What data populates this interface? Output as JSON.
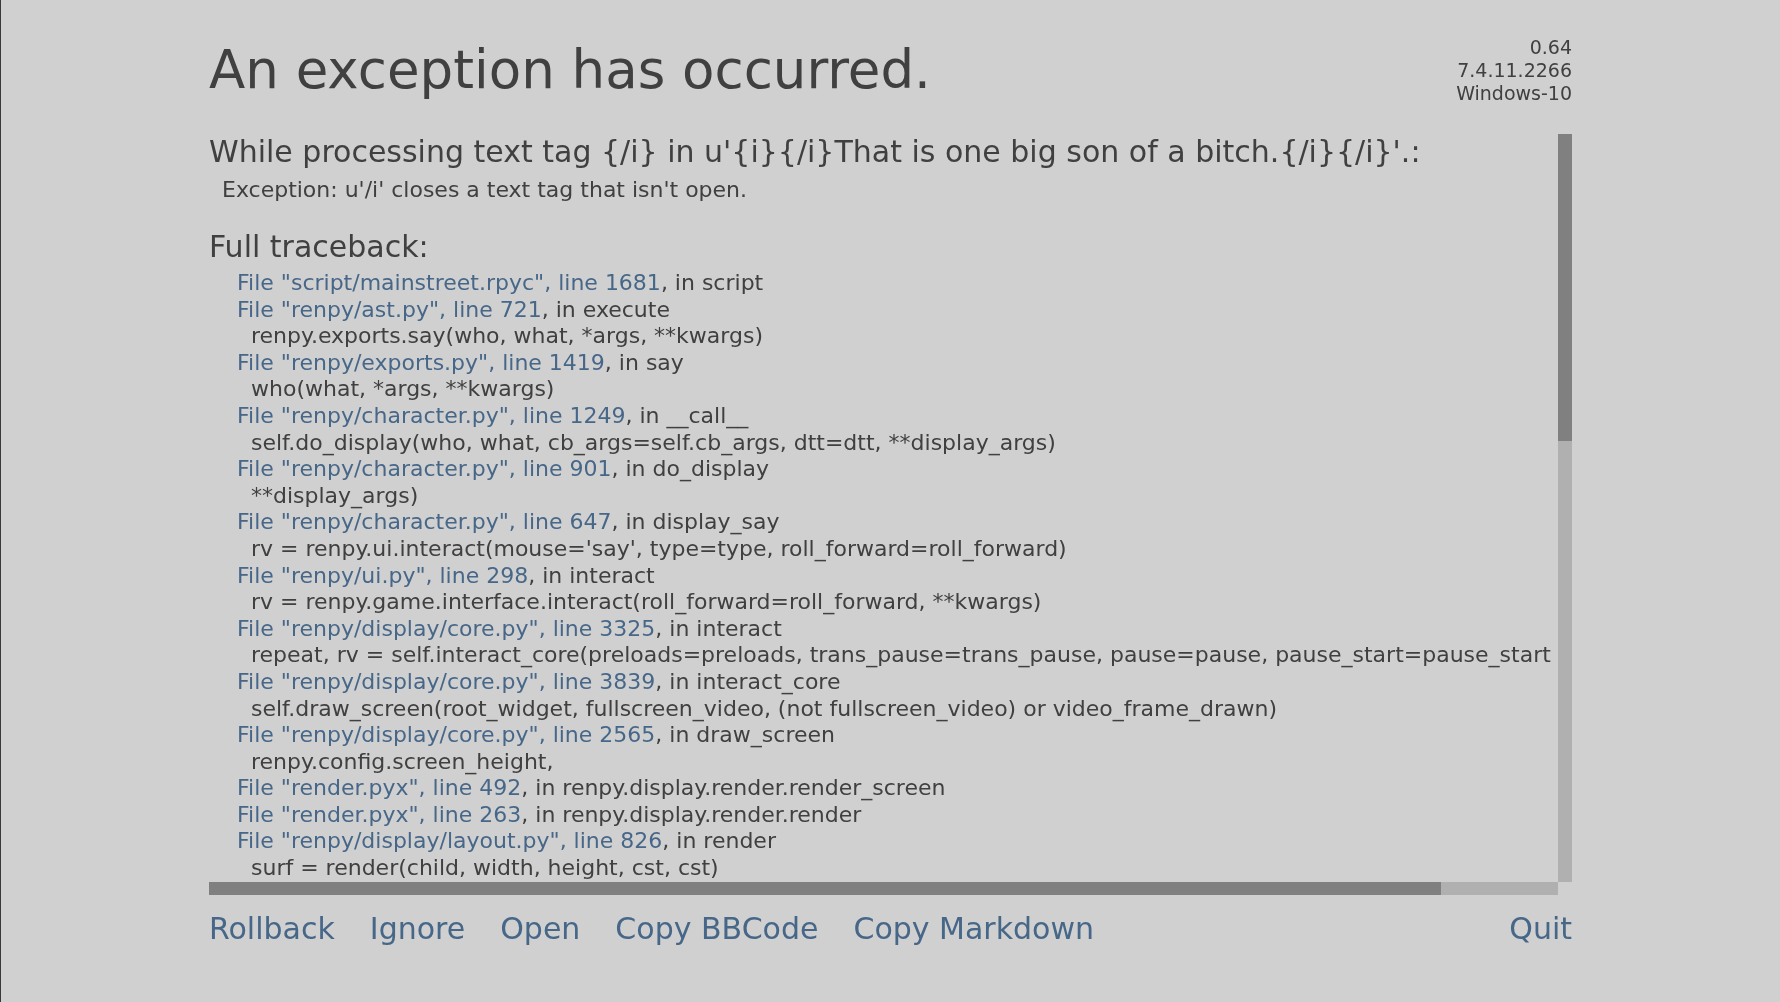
{
  "title": "An exception has occurred.",
  "version_info": [
    "0.64",
    "7.4.11.2266",
    "Windows-10"
  ],
  "message": "While processing text tag {/i} in u'{i}{/i}That is one big son of a bitch.{/i}{/i}'.:",
  "exception": "Exception: u'/i' closes a text tag that isn't open.",
  "traceback_heading": "Full traceback:",
  "traceback": [
    {
      "kind": "location",
      "link": "File \"script/mainstreet.rpyc\", line 1681",
      "text": ", in script"
    },
    {
      "kind": "location",
      "link": "File \"renpy/ast.py\", line 721",
      "text": ", in execute"
    },
    {
      "kind": "code",
      "text": "renpy.exports.say(who, what, *args, **kwargs)"
    },
    {
      "kind": "location",
      "link": "File \"renpy/exports.py\", line 1419",
      "text": ", in say"
    },
    {
      "kind": "code",
      "text": "who(what, *args, **kwargs)"
    },
    {
      "kind": "location",
      "link": "File \"renpy/character.py\", line 1249",
      "text": ", in __call__"
    },
    {
      "kind": "code",
      "text": "self.do_display(who, what, cb_args=self.cb_args, dtt=dtt, **display_args)"
    },
    {
      "kind": "location",
      "link": "File \"renpy/character.py\", line 901",
      "text": ", in do_display"
    },
    {
      "kind": "code",
      "text": "**display_args)"
    },
    {
      "kind": "location",
      "link": "File \"renpy/character.py\", line 647",
      "text": ", in display_say"
    },
    {
      "kind": "code",
      "text": "rv = renpy.ui.interact(mouse='say', type=type, roll_forward=roll_forward)"
    },
    {
      "kind": "location",
      "link": "File \"renpy/ui.py\", line 298",
      "text": ", in interact"
    },
    {
      "kind": "code",
      "text": "rv = renpy.game.interface.interact(roll_forward=roll_forward, **kwargs)"
    },
    {
      "kind": "location",
      "link": "File \"renpy/display/core.py\", line 3325",
      "text": ", in interact"
    },
    {
      "kind": "code",
      "text": "repeat, rv = self.interact_core(preloads=preloads, trans_pause=trans_pause, pause=pause, pause_start=pause_start"
    },
    {
      "kind": "location",
      "link": "File \"renpy/display/core.py\", line 3839",
      "text": ", in interact_core"
    },
    {
      "kind": "code",
      "text": "self.draw_screen(root_widget, fullscreen_video, (not fullscreen_video) or video_frame_drawn)"
    },
    {
      "kind": "location",
      "link": "File \"renpy/display/core.py\", line 2565",
      "text": ", in draw_screen"
    },
    {
      "kind": "code",
      "text": "renpy.config.screen_height,"
    },
    {
      "kind": "location",
      "link": "File \"render.pyx\", line 492",
      "text": ", in renpy.display.render.render_screen"
    },
    {
      "kind": "location",
      "link": "File \"render.pyx\", line 263",
      "text": ", in renpy.display.render.render"
    },
    {
      "kind": "location",
      "link": "File \"renpy/display/layout.py\", line 826",
      "text": ", in render"
    },
    {
      "kind": "code",
      "text": "surf = render(child, width, height, cst, cst)"
    }
  ],
  "buttons": [
    "Rollback",
    "Ignore",
    "Open",
    "Copy BBCode",
    "Copy Markdown"
  ],
  "quit_button": "Quit"
}
